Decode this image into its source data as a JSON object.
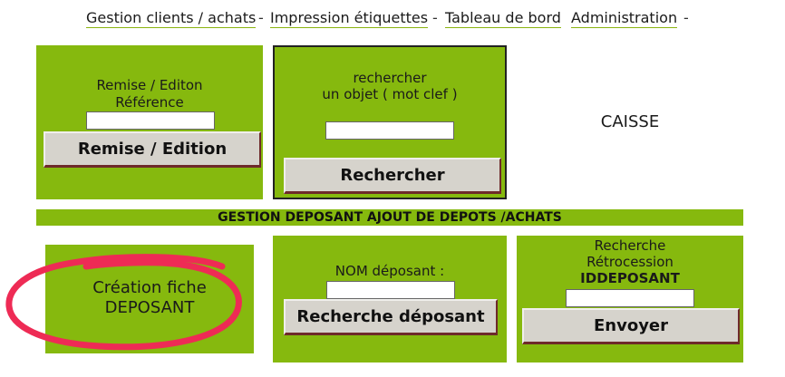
{
  "nav": {
    "items": [
      {
        "label": "Gestion clients / achats"
      },
      {
        "label": "Impression étiquettes"
      },
      {
        "label": "Tableau de bord"
      },
      {
        "label": "Administration"
      }
    ],
    "separator": "-"
  },
  "remise": {
    "line1": "Remise / Editon",
    "line2": "Référence",
    "input_value": "",
    "button_label": "Remise / Edition"
  },
  "recherche_objet": {
    "line1": "rechercher",
    "line2": "un objet ( mot clef )",
    "input_value": "",
    "button_label": "Rechercher"
  },
  "caisse": {
    "label": "CAISSE"
  },
  "section_bar": {
    "title": "GESTION DEPOSANT AJOUT DE DEPOTS /ACHATS"
  },
  "creation": {
    "line1": "Création fiche",
    "line2": "DEPOSANT"
  },
  "nom_deposant": {
    "label": "NOM déposant :",
    "input_value": "",
    "button_label": "Recherche déposant"
  },
  "retrocession": {
    "line1": "Recherche",
    "line2": "Rétrocession",
    "line3": "IDDEPOSANT",
    "input_value": "",
    "button_label": "Envoyer"
  },
  "colors": {
    "panel_green": "#86b90e",
    "annotation_red": "#ee2b55"
  }
}
